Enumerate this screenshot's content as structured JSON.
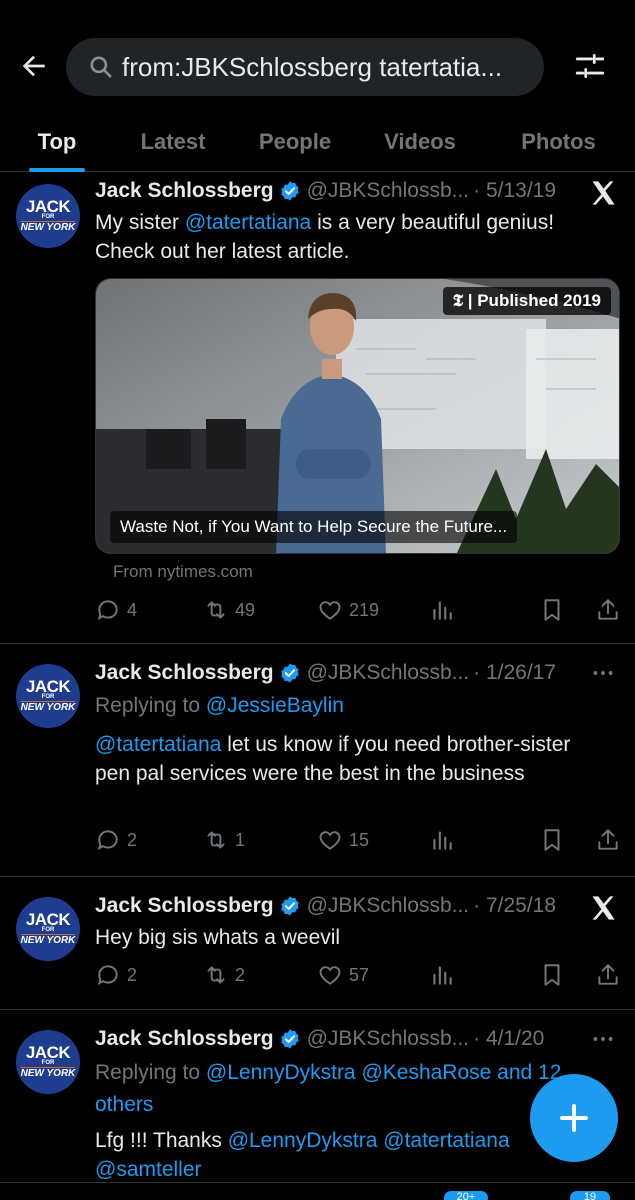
{
  "header": {
    "search_query": "from:JBKSchlossberg tatertatia...",
    "tabs": [
      "Top",
      "Latest",
      "People",
      "Videos",
      "Photos"
    ],
    "active_tab": "Top"
  },
  "avatar": {
    "line1": "JACK",
    "line2": "FOR",
    "line3": "NEW YORK"
  },
  "tweets": [
    {
      "name": "Jack Schlossberg",
      "handle": "@JBKSchlossb...",
      "date": "· 5/13/19",
      "more_icon": "x-logo-icon",
      "mention": "@tatertatiana",
      "text_before": "My sister ",
      "text_after": " is a very beautiful genius! Check out her latest article.",
      "media_badge": "𝕿 | Published 2019",
      "media_caption": "Waste Not, if You Want to Help Secure the Future...",
      "from": "From nytimes.com",
      "replies": "4",
      "reposts": "49",
      "likes": "219"
    },
    {
      "name": "Jack Schlossberg",
      "handle": "@JBKSchlossb...",
      "date": "· 1/26/17",
      "more_icon": "more-dots-icon",
      "reply_prefix": "Replying to ",
      "reply_to": "@JessieBaylin",
      "mention": "@tatertatiana",
      "text_after": " let us know if you need brother-sister pen pal services were the best in the business",
      "replies": "2",
      "reposts": "1",
      "likes": "15"
    },
    {
      "name": "Jack Schlossberg",
      "handle": "@JBKSchlossb...",
      "date": "· 7/25/18",
      "more_icon": "x-logo-icon",
      "text": "Hey big sis whats a weevil",
      "replies": "2",
      "reposts": "2",
      "likes": "57"
    },
    {
      "name": "Jack Schlossberg",
      "handle": "@JBKSchlossb...",
      "date": "· 4/1/20",
      "more_icon": "more-dots-icon",
      "reply_prefix": "Replying to ",
      "reply_to": "@LennyDykstra @KeshaRose and 12 others",
      "text_before": "Lfg !!! Thanks ",
      "mention1": "@LennyDykstra",
      "mention2": "@tatertatiana",
      "mention3": "@samteller"
    }
  ],
  "bottom_nav": {
    "badge1": "20+",
    "badge2": "19"
  },
  "colors": {
    "accent": "#1d9bf0",
    "background": "#000000",
    "muted": "#71767b",
    "avatar_bg": "#1f3d8f"
  }
}
